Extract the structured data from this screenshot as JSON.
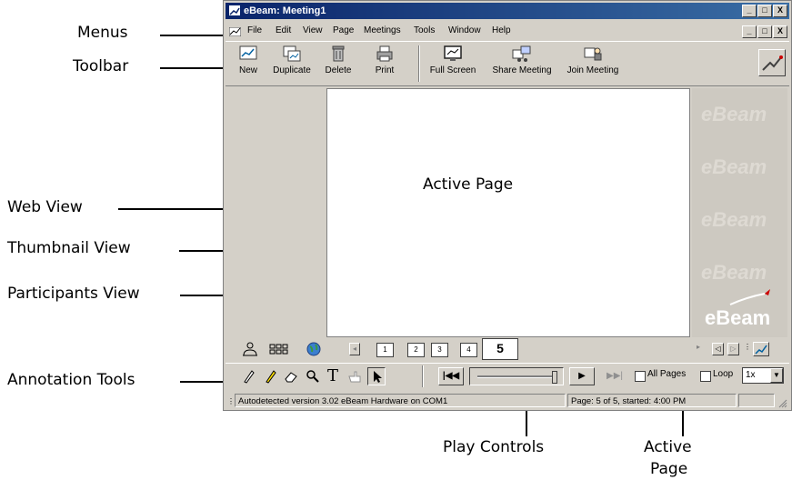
{
  "window": {
    "title": "eBeam: Meeting1",
    "controls": [
      "_",
      "□",
      "X"
    ]
  },
  "menubar": [
    "File",
    "Edit",
    "View",
    "Page",
    "Meetings",
    "Tools",
    "Window",
    "Help"
  ],
  "toolbar": {
    "new": "New",
    "duplicate": "Duplicate",
    "delete": "Delete",
    "print": "Print",
    "full_screen": "Full Screen",
    "share_meeting": "Share Meeting",
    "join_meeting": "Join Meeting"
  },
  "canvas": {
    "label": "Active Page"
  },
  "watermark": {
    "brand": "eBeam"
  },
  "pages": [
    "1",
    "2",
    "3",
    "4",
    "5"
  ],
  "active_page": "5",
  "play_controls": {
    "all_pages_label": "All Pages",
    "loop_label": "Loop",
    "speed": "1x"
  },
  "status": {
    "message": "Autodetected version 3.02 eBeam Hardware on COM1",
    "page_info": "Page: 5 of 5, started: 4:00 PM"
  },
  "callouts": {
    "menus": "Menus",
    "toolbar": "Toolbar",
    "web_view": "Web View",
    "thumbnail_view": "Thumbnail View",
    "participants_view": "Participants View",
    "annotation_tools": "Annotation Tools",
    "play_controls": "Play Controls",
    "active_page_line1": "Active",
    "active_page_line2": "Page"
  },
  "colors": {
    "title_bar": "#0a246a",
    "window_face": "#d4d0c8",
    "brand_red": "#cc0000"
  }
}
